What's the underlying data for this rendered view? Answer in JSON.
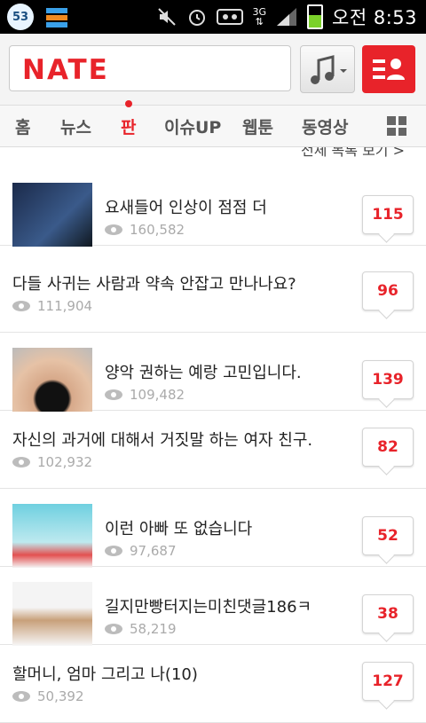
{
  "statusbar": {
    "badge": "53",
    "network": "3G",
    "time": "오전 8:53",
    "icons": [
      "app-badge-icon",
      "app-flag-icon",
      "mute-icon",
      "alarm-icon",
      "voicemail-icon",
      "network-3g-icon",
      "signal-icon",
      "battery-icon"
    ],
    "battery_level": 0.6
  },
  "header": {
    "logo": "NATE",
    "brand_color": "#e8232a"
  },
  "nav": {
    "tabs": [
      {
        "label": "홈"
      },
      {
        "label": "뉴스"
      },
      {
        "label": "판"
      },
      {
        "label": "이슈UP"
      },
      {
        "label": "웹툰"
      },
      {
        "label": "동영상"
      }
    ],
    "active_tab": "판"
  },
  "more_link": "전체 목록 보기 >",
  "posts": [
    {
      "title": "요새들어 인상이 점점 더",
      "views": "160,582",
      "comments": "115",
      "has_thumb": true
    },
    {
      "title": "다들 사귀는 사람과 약속 안잡고 만나나요?",
      "views": "111,904",
      "comments": "96",
      "has_thumb": false
    },
    {
      "title": "양악 권하는 예랑 고민입니다.",
      "views": "109,482",
      "comments": "139",
      "has_thumb": true
    },
    {
      "title": "자신의 과거에 대해서 거짓말 하는 여자 친구.",
      "views": "102,932",
      "comments": "82",
      "has_thumb": false
    },
    {
      "title": "이런 아빠 또 없습니다",
      "views": "97,687",
      "comments": "52",
      "has_thumb": true
    },
    {
      "title": "길지만빵터지는미친댓글186ㅋ",
      "views": "58,219",
      "comments": "38",
      "has_thumb": true
    },
    {
      "title": "할머니, 엄마 그리고 나(10)",
      "views": "50,392",
      "comments": "127",
      "has_thumb": false
    }
  ]
}
